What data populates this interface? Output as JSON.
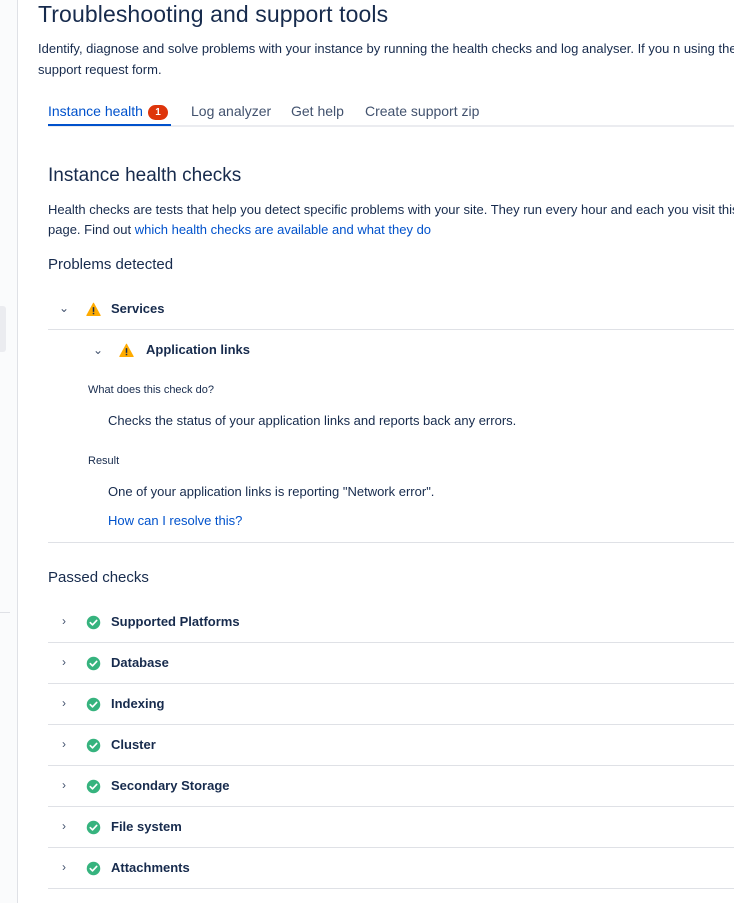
{
  "header": {
    "title": "Troubleshooting and support tools",
    "description": "Identify, diagnose and solve problems with your instance by running the health checks and log analyser. If you n using the support request form."
  },
  "tabs": [
    {
      "label": "Instance health",
      "badge": "1",
      "active": true
    },
    {
      "label": "Log analyzer",
      "active": false
    },
    {
      "label": "Get help",
      "active": false
    },
    {
      "label": "Create support zip",
      "active": false
    }
  ],
  "health": {
    "title": "Instance health checks",
    "description": "Health checks are tests that help you detect specific problems with your site. They run every hour and each you visit this page. Find out ",
    "description_link": "which health checks are available and what they do"
  },
  "problems": {
    "heading": "Problems detected",
    "group": {
      "label": "Services",
      "icon": "warning-icon",
      "item": {
        "label": "Application links",
        "icon": "warning-icon",
        "what_label": "What does this check do?",
        "what_text": "Checks the status of your application links and reports back any errors.",
        "result_label": "Result",
        "result_text": "One of your application links is reporting \"Network error\".",
        "resolve_link": "How can I resolve this?"
      }
    }
  },
  "passed": {
    "heading": "Passed checks",
    "items": [
      {
        "label": "Supported Platforms"
      },
      {
        "label": "Database"
      },
      {
        "label": "Indexing"
      },
      {
        "label": "Cluster"
      },
      {
        "label": "Secondary Storage"
      },
      {
        "label": "File system"
      },
      {
        "label": "Attachments"
      }
    ]
  },
  "colors": {
    "link": "#0052cc",
    "warning": "#ffab00",
    "success": "#36b37e",
    "badge": "#de350b",
    "text": "#172b4d"
  }
}
